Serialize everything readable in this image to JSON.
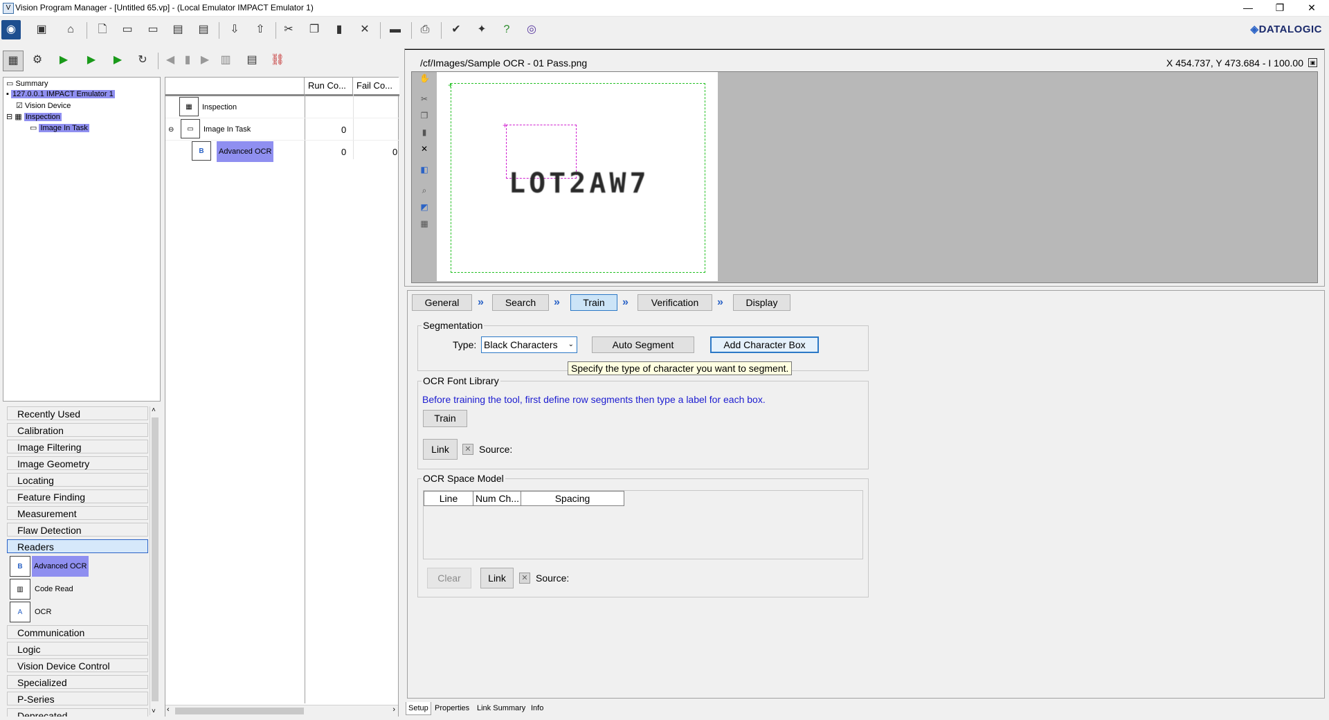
{
  "window": {
    "title": "Vision Program Manager - [Untitled 65.vp] - (Local Emulator IMPACT Emulator 1)",
    "minimize": "—",
    "restore": "❐",
    "close": "✕"
  },
  "brand": {
    "logo_text": "DATALOGIC"
  },
  "explorer_tree": {
    "summary": "Summary",
    "device_host": "127.0.0.1 IMPACT Emulator 1",
    "vision_device": "Vision Device",
    "inspection": "Inspection",
    "image_in_task": "Image In Task"
  },
  "task_table": {
    "columns": [
      "Run Co...",
      "Fail Co..."
    ],
    "rows": [
      {
        "name": "Inspection",
        "run": "",
        "fail": ""
      },
      {
        "name": "Image In Task",
        "run": "0",
        "fail": ""
      },
      {
        "name": "Advanced OCR",
        "run": "0",
        "fail": "0"
      }
    ]
  },
  "toolbox": {
    "categories_top": [
      "Recently Used",
      "Calibration",
      "Image Filtering",
      "Image Geometry",
      "Locating",
      "Feature Finding",
      "Measurement",
      "Flaw Detection",
      "Readers"
    ],
    "readers_tools": [
      "Advanced OCR",
      "Code Read",
      "OCR"
    ],
    "categories_bottom": [
      "Communication",
      "Logic",
      "Vision Device Control",
      "Specialized",
      "P-Series",
      "Deprecated"
    ]
  },
  "image_view": {
    "path": "/cf/Images/Sample OCR - 01 Pass.png",
    "cursor_readout": "X 454.737,  Y 473.684  -  I 100.00",
    "ocr_text": "LOT2AW7"
  },
  "wizard_tabs": [
    "General",
    "Search",
    "Train",
    "Verification",
    "Display"
  ],
  "wizard_active": "Train",
  "segmentation": {
    "title": "Segmentation",
    "type_label": "Type:",
    "type_value": "Black Characters",
    "auto_segment": "Auto Segment",
    "add_char_box": "Add Character Box",
    "tooltip": "Specify the type of character you want to segment."
  },
  "font_library": {
    "title": "OCR Font Library",
    "hint": "Before training the tool, first define row segments then type a label for each box.",
    "train": "Train",
    "link": "Link",
    "source_label": "Source:"
  },
  "space_model": {
    "title": "OCR Space Model",
    "columns": [
      "Line",
      "Num Ch...",
      "Spacing"
    ],
    "clear": "Clear",
    "link": "Link",
    "source_label": "Source:"
  },
  "bottom_tabs": [
    "Setup",
    "Properties",
    "Link Summary",
    "Info"
  ],
  "colors": {
    "selection": "#8f8ff0",
    "hint_text": "#1c1cd0",
    "roi_green": "#22c022",
    "roi_magenta": "#d020d0",
    "accent_blue": "#2b63c6"
  }
}
